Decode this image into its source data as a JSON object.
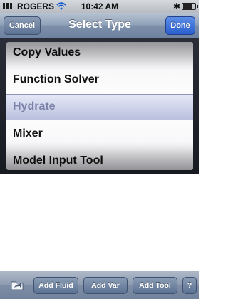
{
  "status_bar": {
    "carrier": "ROGERS",
    "time": "10:42 AM",
    "bluetooth_icon": "✱",
    "battery_level": 0.85
  },
  "nav_bar": {
    "title": "Select Type",
    "cancel_label": "Cancel",
    "done_label": "Done"
  },
  "picker": {
    "items": [
      {
        "label": "Copy Values"
      },
      {
        "label": "Function Solver"
      },
      {
        "label": "Hydrate"
      },
      {
        "label": "Mixer"
      },
      {
        "label": "Model Input Tool"
      }
    ],
    "selected_index": 2
  },
  "toolbar": {
    "icon": "folder-share-icon",
    "add_fluid_label": "Add Fluid",
    "add_var_label": "Add Var",
    "add_tool_label": "Add Tool",
    "help_label": "?"
  }
}
